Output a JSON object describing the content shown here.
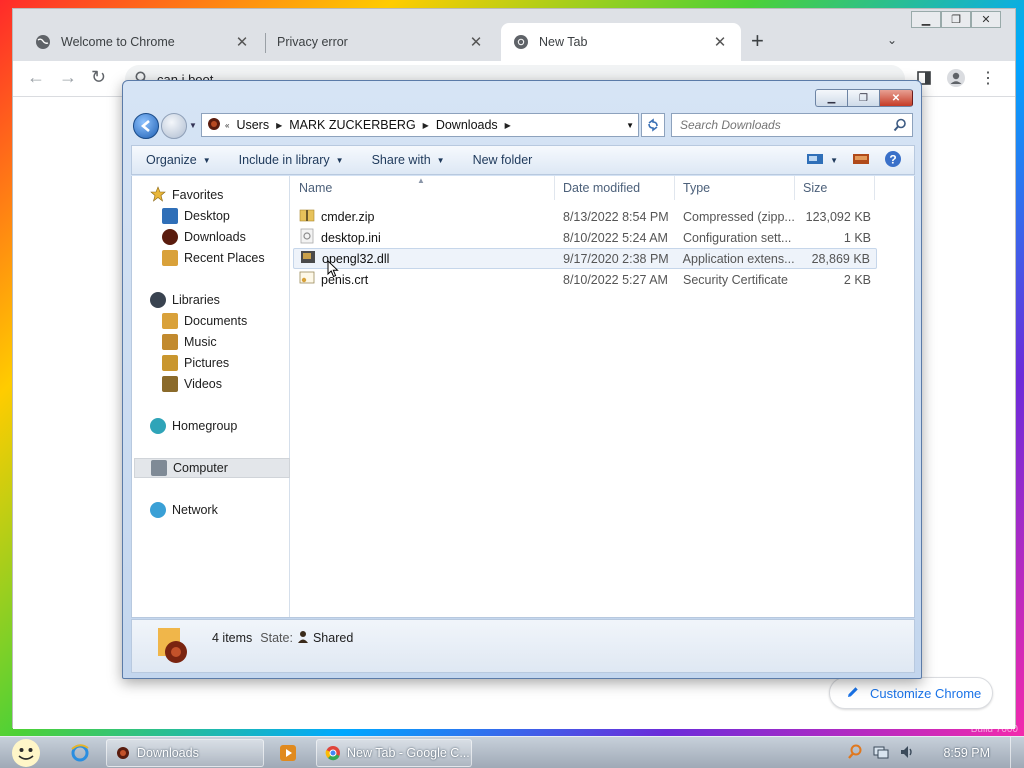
{
  "chrome": {
    "tabs": [
      {
        "title": "Welcome to Chrome",
        "active": false
      },
      {
        "title": "Privacy error",
        "active": false
      },
      {
        "title": "New Tab",
        "active": true
      }
    ],
    "omnibox_text": "can i boot",
    "customize_label": "Customize Chrome"
  },
  "explorer": {
    "breadcrumb": [
      "Users",
      "MARK ZUCKERBERG",
      "Downloads"
    ],
    "search_placeholder": "Search Downloads",
    "commands": [
      "Organize",
      "Include in library",
      "Share with",
      "New folder"
    ],
    "nav": {
      "favorites": "Favorites",
      "desktop": "Desktop",
      "downloads": "Downloads",
      "recent_places": "Recent Places",
      "libraries": "Libraries",
      "documents": "Documents",
      "music": "Music",
      "pictures": "Pictures",
      "videos": "Videos",
      "homegroup": "Homegroup",
      "computer": "Computer",
      "network": "Network"
    },
    "columns": {
      "name": "Name",
      "date": "Date modified",
      "type": "Type",
      "size": "Size"
    },
    "files": [
      {
        "name": "cmder.zip",
        "date": "8/13/2022 8:54 PM",
        "type": "Compressed (zipp...",
        "size": "123,092 KB",
        "icon": "zip-folder-icon"
      },
      {
        "name": "desktop.ini",
        "date": "8/10/2022 5:24 AM",
        "type": "Configuration sett...",
        "size": "1 KB",
        "icon": "ini-file-icon"
      },
      {
        "name": "opengl32.dll",
        "date": "9/17/2020 2:38 PM",
        "type": "Application extens...",
        "size": "28,869 KB",
        "icon": "dll-file-icon"
      },
      {
        "name": "penis.crt",
        "date": "8/10/2022 5:27 AM",
        "type": "Security Certificate",
        "size": "2 KB",
        "icon": "certificate-icon"
      }
    ],
    "details": {
      "count": "4 items",
      "state_label": "State:",
      "state_value": "Shared"
    }
  },
  "taskbar": {
    "buttons": [
      {
        "label": "Downloads"
      },
      {
        "label": "New Tab - Google C..."
      }
    ],
    "clock": "8:59 PM"
  },
  "watermark": "Build 7600"
}
